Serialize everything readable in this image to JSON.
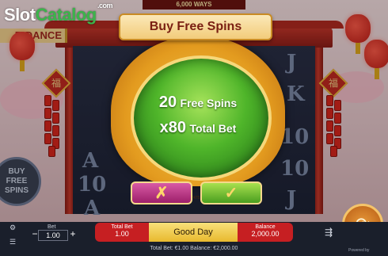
{
  "logo": {
    "part1": "Slot",
    "part2": "Catalog",
    "suffix": ".com"
  },
  "game": {
    "ways_banner": "6,000 WAYS",
    "title_fragment": "R DANCE",
    "side_sign": "FREE SPINS",
    "side_sign_prefix": "BUY"
  },
  "modal": {
    "title": "Buy Free Spins",
    "line1_num": "20",
    "line1_text": "Free Spins",
    "line2_num": "x80",
    "line2_text": "Total Bet",
    "cancel_glyph": "✗",
    "confirm_glyph": "✓"
  },
  "reel_symbols": [
    "J",
    "K",
    "10",
    "A",
    "10",
    "J",
    "A",
    "10"
  ],
  "fu_char": "福",
  "bet": {
    "label": "Bet",
    "value": "1.00",
    "minus": "−",
    "plus": "+"
  },
  "status": {
    "total_bet_label": "Total Bet",
    "total_bet_value": "1.00",
    "message": "Good Day",
    "balance_label": "Balance",
    "balance_value": "2,000.00",
    "round_id": "7217747516"
  },
  "footer": {
    "text": "Total Bet: €1.00  Balance: €2,000.00",
    "powered": "Powered by"
  },
  "icons": {
    "spin": "spin-icon",
    "autoplay": "autoplay-icon",
    "settings": "settings-icon",
    "menu": "menu-icon"
  }
}
